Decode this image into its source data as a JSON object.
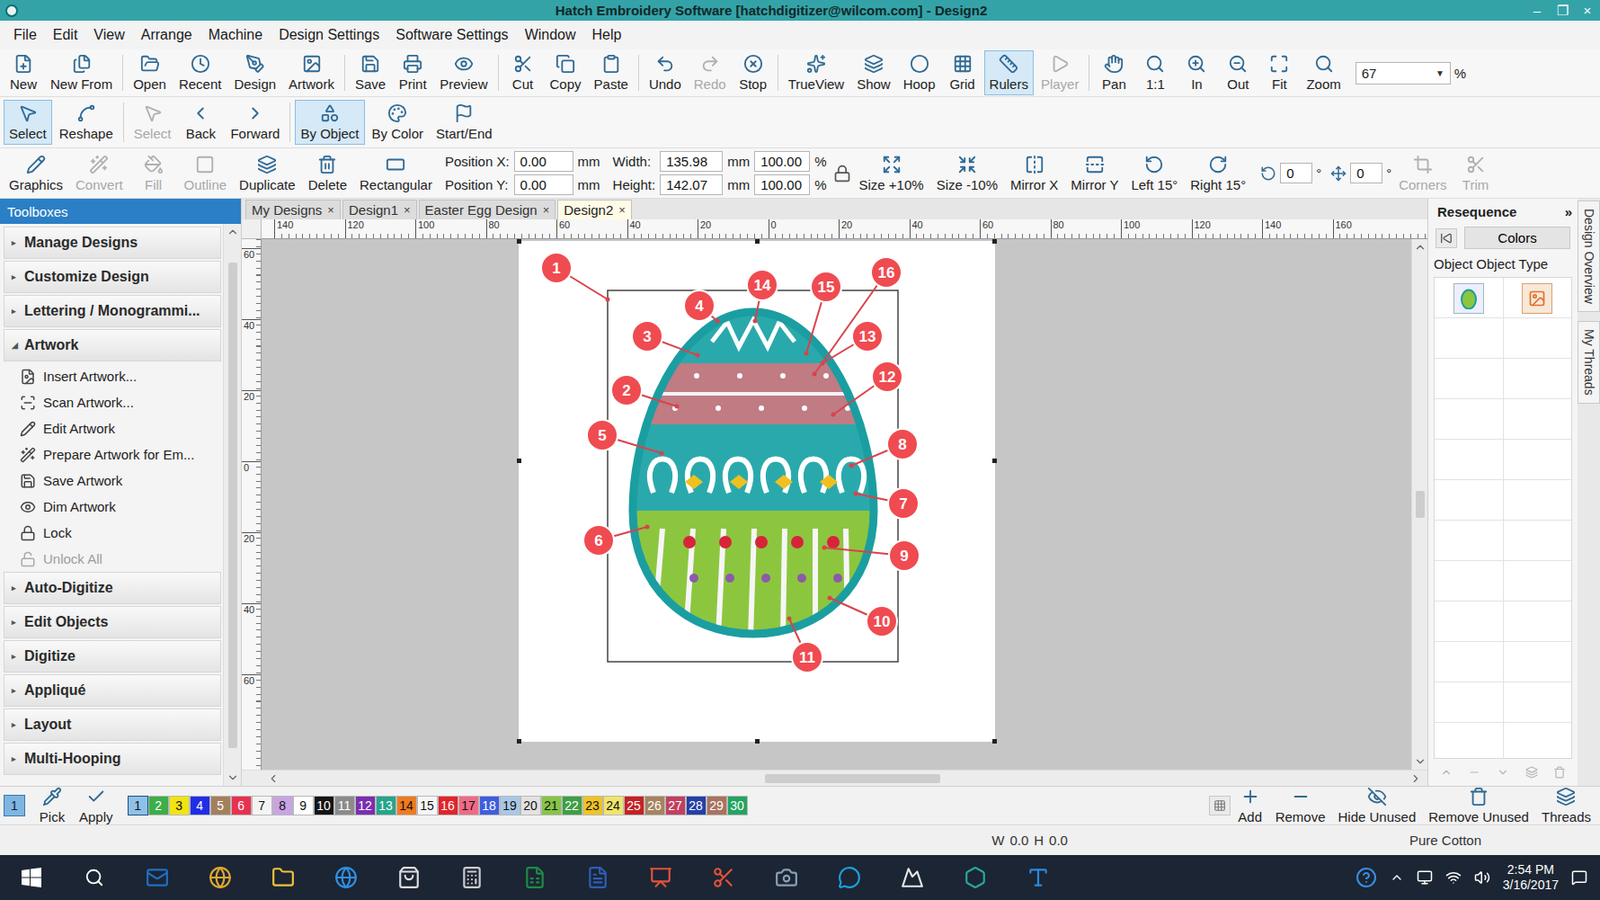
{
  "window": {
    "title": "Hatch Embroidery Software [hatchdigitizer@wilcom.com] - Design2",
    "controls": [
      "–",
      "❐",
      "×"
    ]
  },
  "menu": [
    "File",
    "Edit",
    "View",
    "Arrange",
    "Machine",
    "Design Settings",
    "Software Settings",
    "Window",
    "Help"
  ],
  "main_toolbar": {
    "buttons": [
      {
        "label": "New",
        "disabled": false,
        "active": false
      },
      {
        "label": "New From",
        "disabled": false,
        "active": false
      },
      {
        "label": "Open",
        "disabled": false,
        "active": false
      },
      {
        "label": "Recent",
        "disabled": false,
        "active": false
      },
      {
        "label": "Design",
        "disabled": false,
        "active": false
      },
      {
        "label": "Artwork",
        "disabled": false,
        "active": false
      },
      {
        "label": "Save",
        "disabled": false,
        "active": false
      },
      {
        "label": "Print",
        "disabled": false,
        "active": false
      },
      {
        "label": "Preview",
        "disabled": false,
        "active": false
      },
      {
        "label": "Cut",
        "disabled": false,
        "active": false
      },
      {
        "label": "Copy",
        "disabled": false,
        "active": false
      },
      {
        "label": "Paste",
        "disabled": false,
        "active": false
      },
      {
        "label": "Undo",
        "disabled": false,
        "active": false
      },
      {
        "label": "Redo",
        "disabled": true,
        "active": false
      },
      {
        "label": "Stop",
        "disabled": false,
        "active": false
      },
      {
        "label": "TrueView",
        "disabled": false,
        "active": false
      },
      {
        "label": "Show",
        "disabled": false,
        "active": false
      },
      {
        "label": "Hoop",
        "disabled": false,
        "active": false
      },
      {
        "label": "Grid",
        "disabled": false,
        "active": false
      },
      {
        "label": "Rulers",
        "disabled": false,
        "active": true
      },
      {
        "label": "Player",
        "disabled": true,
        "active": false
      },
      {
        "label": "Pan",
        "disabled": false,
        "active": false
      },
      {
        "label": "1:1",
        "disabled": false,
        "active": false
      },
      {
        "label": "In",
        "disabled": false,
        "active": false
      },
      {
        "label": "Out",
        "disabled": false,
        "active": false
      },
      {
        "label": "Fit",
        "disabled": false,
        "active": false
      },
      {
        "label": "Zoom",
        "disabled": false,
        "active": false
      }
    ],
    "zoom": {
      "value": "67",
      "arrow": "▼",
      "unit": "%"
    }
  },
  "edit_toolbar": {
    "buttons": [
      {
        "label": "Select",
        "disabled": false,
        "active": true
      },
      {
        "label": "Reshape",
        "disabled": false,
        "active": false
      },
      {
        "label": "Select",
        "disabled": true,
        "active": false
      },
      {
        "label": "Back",
        "disabled": false,
        "active": false
      },
      {
        "label": "Forward",
        "disabled": false,
        "active": false
      },
      {
        "label": "By Object",
        "disabled": false,
        "active": true
      },
      {
        "label": "By Color",
        "disabled": false,
        "active": false
      },
      {
        "label": "Start/End",
        "disabled": false,
        "active": false
      }
    ]
  },
  "object_toolbar": {
    "left": [
      {
        "label": "Graphics",
        "disabled": false
      },
      {
        "label": "Convert",
        "disabled": true
      },
      {
        "label": "Fill",
        "disabled": true
      },
      {
        "label": "Outline",
        "disabled": true
      },
      {
        "label": "Duplicate",
        "disabled": false
      },
      {
        "label": "Delete",
        "disabled": false
      },
      {
        "label": "Rectangular",
        "disabled": false
      }
    ],
    "position": [
      {
        "label": "Position X:",
        "value": "0.00",
        "unit": "mm"
      },
      {
        "label": "Position Y:",
        "value": "0.00",
        "unit": "mm"
      }
    ],
    "size": [
      {
        "label": "Width:",
        "value": "135.98",
        "unit": "mm",
        "percent": "100.00",
        "percent_unit": "%"
      },
      {
        "label": "Height:",
        "value": "142.07",
        "unit": "mm",
        "percent": "100.00",
        "percent_unit": "%"
      }
    ],
    "right": [
      {
        "label": "Size +10%",
        "disabled": false
      },
      {
        "label": "Size -10%",
        "disabled": false
      },
      {
        "label": "Mirror X",
        "disabled": false
      },
      {
        "label": "Mirror Y",
        "disabled": false
      },
      {
        "label": "Left 15°",
        "disabled": false
      },
      {
        "label": "Right 15°",
        "disabled": false
      }
    ],
    "rotate": {
      "value": "0",
      "unit": "°"
    },
    "skew": {
      "value": "0",
      "unit": "°"
    },
    "end": [
      {
        "label": "Corners",
        "disabled": true
      },
      {
        "label": "Trim",
        "disabled": true
      }
    ]
  },
  "toolboxes": {
    "title": "Toolboxes",
    "items": [
      {
        "label": "Manage Designs",
        "expanded": false,
        "children": []
      },
      {
        "label": "Customize Design",
        "expanded": false,
        "children": []
      },
      {
        "label": "Lettering / Monogrammi...",
        "expanded": false,
        "children": []
      },
      {
        "label": "Artwork",
        "expanded": true,
        "children": [
          {
            "label": "Insert Artwork...",
            "disabled": false
          },
          {
            "label": "Scan Artwork...",
            "disabled": false
          },
          {
            "label": "Edit Artwork",
            "disabled": false
          },
          {
            "label": "Prepare Artwork for Em...",
            "disabled": false
          },
          {
            "label": "Save Artwork",
            "disabled": false
          },
          {
            "label": "Dim Artwork",
            "disabled": false
          },
          {
            "label": "Lock",
            "disabled": false
          },
          {
            "label": "Unlock All",
            "disabled": true
          }
        ]
      },
      {
        "label": "Auto-Digitize",
        "expanded": false,
        "children": []
      },
      {
        "label": "Edit Objects",
        "expanded": false,
        "children": []
      },
      {
        "label": "Digitize",
        "expanded": false,
        "children": []
      },
      {
        "label": "Appliqué",
        "expanded": false,
        "children": []
      },
      {
        "label": "Layout",
        "expanded": false,
        "children": []
      },
      {
        "label": "Multi-Hooping",
        "expanded": false,
        "children": []
      }
    ]
  },
  "tabs": [
    {
      "label": "My Designs",
      "selected": false
    },
    {
      "label": "Design1",
      "selected": false
    },
    {
      "label": "Easter Egg Design",
      "selected": false
    },
    {
      "label": "Design2",
      "selected": true
    }
  ],
  "tab_close": "×",
  "ruler_top": [
    "140",
    "120",
    "100",
    "80",
    "60",
    "40",
    "20",
    "0",
    "20",
    "40",
    "60",
    "80",
    "100",
    "120",
    "140",
    "160"
  ],
  "ruler_left": [
    "60",
    "40",
    "20",
    "0",
    "20",
    "40",
    "60"
  ],
  "callouts": [
    "1",
    "2",
    "3",
    "4",
    "5",
    "6",
    "7",
    "8",
    "9",
    "10",
    "11",
    "12",
    "13",
    "14",
    "15",
    "16"
  ],
  "resequence": {
    "title": "Resequence",
    "expand": "»",
    "colors_button": "Colors",
    "columns": [
      "Object",
      "Object Type"
    ]
  },
  "side_tabs": [
    "Design Overview",
    "My Threads"
  ],
  "colorbar": {
    "current": "1",
    "tools": [
      "Pick",
      "Apply"
    ],
    "swatches": [
      {
        "label": "1",
        "color": "#8ec1e8",
        "selected": true
      },
      {
        "label": "2",
        "color": "#3cae4a",
        "selected": false
      },
      {
        "label": "3",
        "color": "#f2e312",
        "selected": false
      },
      {
        "label": "4",
        "color": "#1f2ee6",
        "selected": false
      },
      {
        "label": "5",
        "color": "#a3805c",
        "selected": false
      },
      {
        "label": "6",
        "color": "#e8314f",
        "selected": false
      },
      {
        "label": "7",
        "color": "#f4f4f4",
        "selected": false
      },
      {
        "label": "8",
        "color": "#c9a3e3",
        "selected": false
      },
      {
        "label": "9",
        "color": "#ffffff",
        "selected": false
      },
      {
        "label": "10",
        "color": "#141414",
        "selected": false
      },
      {
        "label": "11",
        "color": "#8b8b8b",
        "selected": false
      },
      {
        "label": "12",
        "color": "#7a2fb0",
        "selected": false
      },
      {
        "label": "13",
        "color": "#25a58c",
        "selected": false
      },
      {
        "label": "14",
        "color": "#f07a1e",
        "selected": false
      },
      {
        "label": "15",
        "color": "#f6f6f6",
        "selected": false
      },
      {
        "label": "16",
        "color": "#e3232a",
        "selected": false
      },
      {
        "label": "17",
        "color": "#f06a86",
        "selected": false
      },
      {
        "label": "18",
        "color": "#3f5ee0",
        "selected": false
      },
      {
        "label": "19",
        "color": "#a9c8e6",
        "selected": false
      },
      {
        "label": "20",
        "color": "#e2e2e2",
        "selected": false
      },
      {
        "label": "21",
        "color": "#86c446",
        "selected": false
      },
      {
        "label": "22",
        "color": "#3f9f45",
        "selected": false
      },
      {
        "label": "23",
        "color": "#f0c322",
        "selected": false
      },
      {
        "label": "24",
        "color": "#f1e46a",
        "selected": false
      },
      {
        "label": "25",
        "color": "#c42225",
        "selected": false
      },
      {
        "label": "26",
        "color": "#a6845e",
        "selected": false
      },
      {
        "label": "27",
        "color": "#c1405f",
        "selected": false
      },
      {
        "label": "28",
        "color": "#2440a6",
        "selected": false
      },
      {
        "label": "29",
        "color": "#a8735e",
        "selected": false
      },
      {
        "label": "30",
        "color": "#23a461",
        "selected": false
      }
    ],
    "actions": [
      "Add",
      "Remove",
      "Hide Unused",
      "Remove Unused",
      "Threads"
    ]
  },
  "status": {
    "w_label": "W",
    "w_value": "0.0",
    "h_label": "H",
    "h_value": "0.0",
    "thread": "Pure Cotton"
  },
  "taskbar": {
    "time": "2:54 PM",
    "date": "3/16/2017"
  }
}
